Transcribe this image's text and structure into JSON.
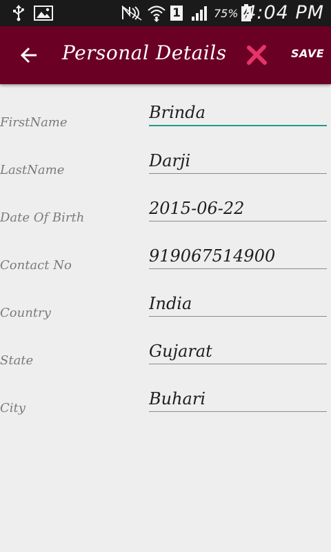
{
  "status_bar": {
    "battery_percent": "75%",
    "time": "4:04 PM",
    "icons": [
      "usb-icon",
      "image-icon",
      "nfc-muted-icon",
      "wifi-icon",
      "sim-1-icon",
      "signal-icon",
      "battery-charging-icon"
    ],
    "sim_label": "1"
  },
  "app_bar": {
    "title": "Personal Details",
    "back_icon": "arrow-back-icon",
    "cancel_icon": "close-x-icon",
    "save_label": "SAVE",
    "colors": {
      "background": "#6b0025",
      "cancel": "#e8336a",
      "text": "#ffffff"
    }
  },
  "form": {
    "fields": [
      {
        "label": "FirstName",
        "value": "Brinda",
        "focused": true
      },
      {
        "label": "LastName",
        "value": "Darji",
        "focused": false
      },
      {
        "label": "Date Of Birth",
        "value": "2015-06-22",
        "focused": false
      },
      {
        "label": "Contact No",
        "value": "919067514900",
        "focused": false
      },
      {
        "label": "Country",
        "value": "India",
        "focused": false
      },
      {
        "label": "State",
        "value": "Gujarat",
        "focused": false
      },
      {
        "label": "City",
        "value": "Buhari",
        "focused": false
      }
    ],
    "focus_color": "#229987"
  }
}
